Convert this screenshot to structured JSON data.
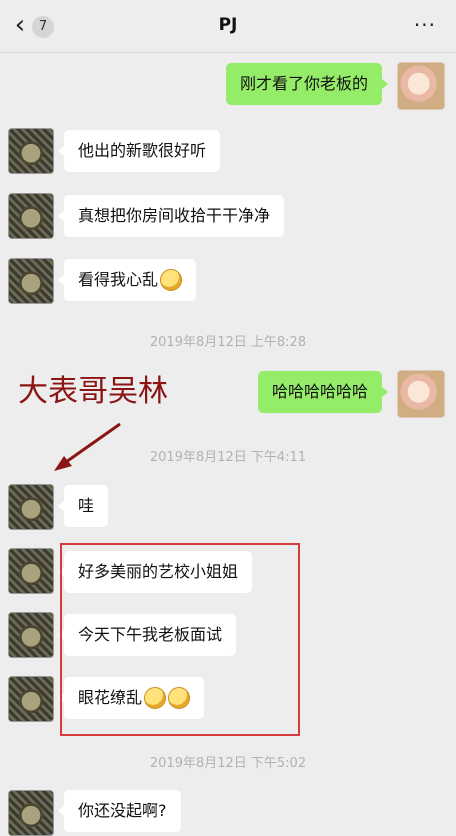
{
  "navbar": {
    "back_icon": "‹",
    "unread_count": "7",
    "title": "PJ",
    "more_icon": "···"
  },
  "messages": [
    {
      "id": "m1",
      "side": "self",
      "text": "刚才看了你老板的"
    },
    {
      "id": "m2",
      "side": "other",
      "text": "他出的新歌很好听"
    },
    {
      "id": "m3",
      "side": "other",
      "text": "真想把你房间收拾干干净净"
    },
    {
      "id": "m4",
      "side": "other",
      "text": "看得我心乱",
      "emoji_count": 1
    },
    {
      "id": "t1",
      "type": "timestamp",
      "text": "2019年8月12日 上午8:28"
    },
    {
      "id": "m5",
      "side": "self",
      "text": "哈哈哈哈哈哈"
    },
    {
      "id": "t2",
      "type": "timestamp",
      "text": "2019年8月12日 下午4:11"
    },
    {
      "id": "m6",
      "side": "other",
      "text": "哇"
    },
    {
      "id": "m7",
      "side": "other",
      "text": "好多美丽的艺校小姐姐"
    },
    {
      "id": "m8",
      "side": "other",
      "text": "今天下午我老板面试"
    },
    {
      "id": "m9",
      "side": "other",
      "text": "眼花缭乱",
      "emoji_count": 2
    },
    {
      "id": "t3",
      "type": "timestamp",
      "text": "2019年8月12日 下午5:02"
    },
    {
      "id": "m10",
      "side": "other",
      "text": "你还没起啊?"
    }
  ],
  "annotation": {
    "label": "大表哥吴林",
    "color": "#8b1414",
    "highlight_color": "#d63a3a"
  },
  "colors": {
    "self_bubble": "#95ec69",
    "other_bubble": "#ffffff",
    "background": "#ededed"
  }
}
